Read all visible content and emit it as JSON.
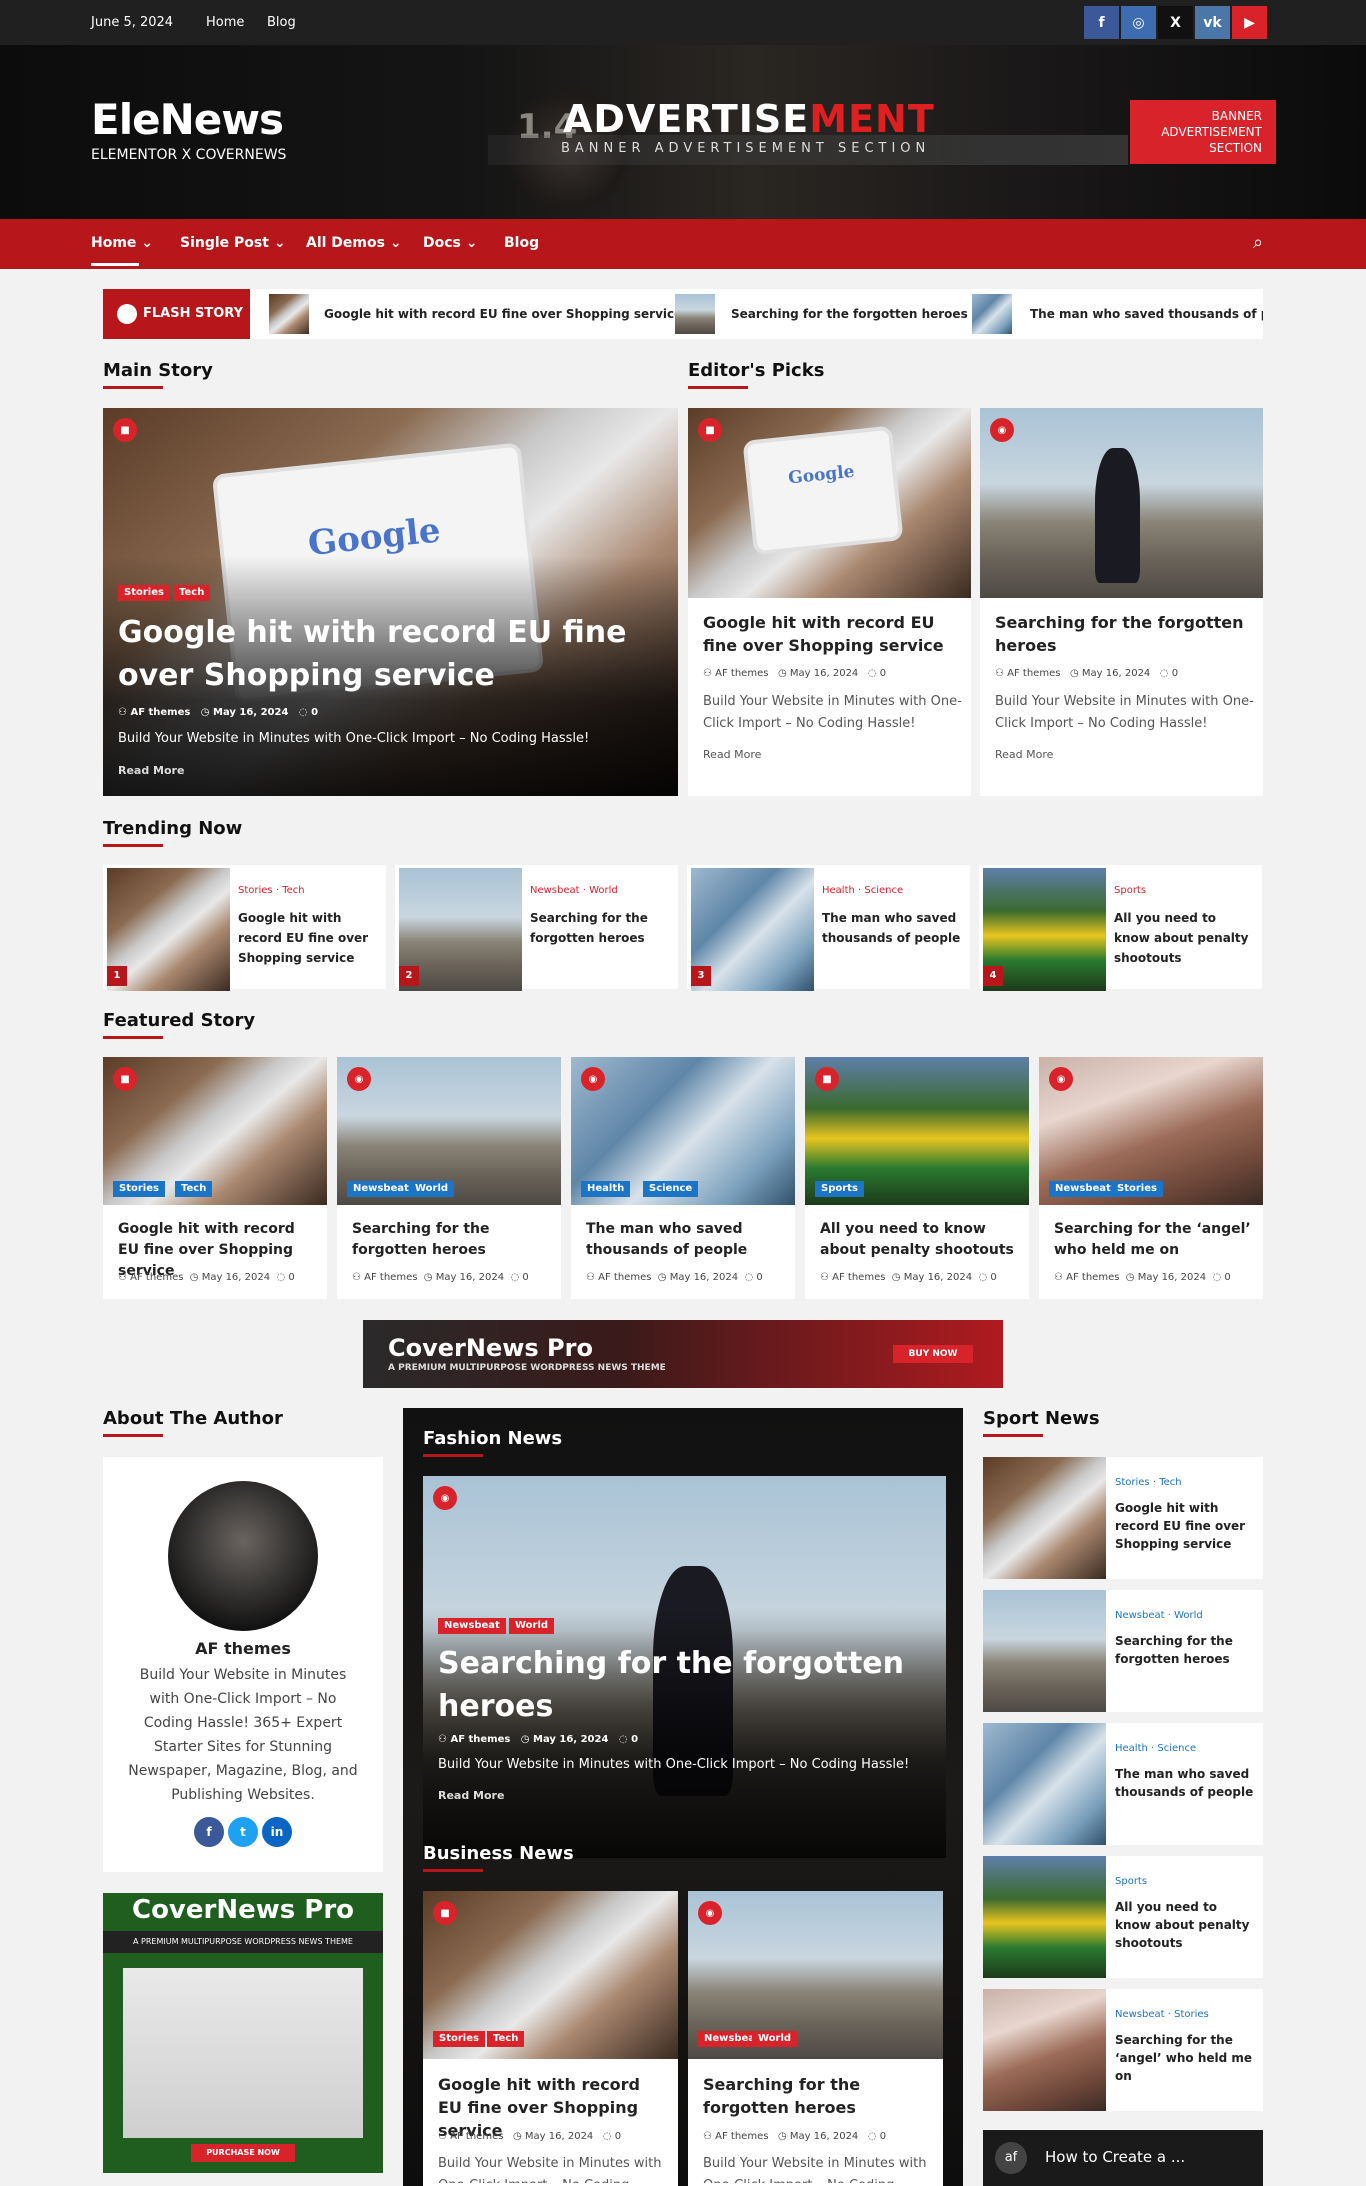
{
  "topbar": {
    "date": "June 5, 2024",
    "links": [
      "Home",
      "Blog"
    ],
    "social": [
      {
        "name": "facebook-icon",
        "glyph": "f",
        "color": "#3b5998"
      },
      {
        "name": "instagram-icon",
        "glyph": "◎",
        "color": "#3e6cb0"
      },
      {
        "name": "x-icon",
        "glyph": "X",
        "color": "#111111"
      },
      {
        "name": "vk-icon",
        "glyph": "vk",
        "color": "#4a76a8"
      },
      {
        "name": "youtube-icon",
        "glyph": "▶",
        "color": "#d9232a"
      }
    ]
  },
  "header": {
    "logo": "EleNews",
    "tagline": "ELEMENTOR X COVERNEWS",
    "ad_title_a": "ADVERTISE",
    "ad_title_b": "MENT",
    "ad_sub": "BANNER ADVERTISEMENT SECTION",
    "ad_badge": [
      "BANNER",
      "ADVERTISEMENT",
      "SECTION"
    ],
    "ad_lens_text": "1.4"
  },
  "nav": {
    "items": [
      "Home",
      "Single Post",
      "All Demos",
      "Docs",
      "Blog"
    ]
  },
  "flash": {
    "label": "FLASH STORY",
    "items": [
      "Google hit with record EU fine over Shopping service",
      "Searching for the forgotten heroes",
      "The man who saved thousands of peop"
    ]
  },
  "sections": {
    "main": "Main Story",
    "editors": "Editor's Picks",
    "trending": "Trending Now",
    "featured": "Featured Story",
    "about": "About The Author",
    "fashion": "Fashion News",
    "business": "Business News",
    "sport": "Sport News"
  },
  "common": {
    "author": "AF themes",
    "date": "May 16, 2024",
    "comments": "0",
    "excerpt": "Build Your Website in Minutes with One-Click Import – No Coding Hassle!",
    "read_more": "Read More"
  },
  "main_story": {
    "tags": [
      "Stories",
      "Tech"
    ],
    "title": "Google hit with record EU fine over Shopping service",
    "excerpt": "Build Your Website in Minutes with One-Click Import – No Coding Hassle!"
  },
  "editors": [
    {
      "title": "Google hit with record EU fine over Shopping service"
    },
    {
      "title": "Searching for the forgotten heroes"
    }
  ],
  "trending": [
    {
      "cats": [
        "Stories",
        "Tech"
      ],
      "title": "Google hit with record EU fine over Shopping service",
      "num": "1"
    },
    {
      "cats": [
        "Newsbeat",
        "World"
      ],
      "title": "Searching for the forgotten heroes",
      "num": "2"
    },
    {
      "cats": [
        "Health",
        "Science"
      ],
      "title": "The man who saved thousands of people",
      "num": "3"
    },
    {
      "cats": [
        "Sports"
      ],
      "title": "All you need to know about penalty shootouts",
      "num": "4"
    }
  ],
  "featured": [
    {
      "tags": [
        "Stories",
        "Tech"
      ],
      "title": "Google hit with record EU fine over Shopping service"
    },
    {
      "tags": [
        "Newsbeat",
        "World"
      ],
      "title": "Searching for the forgotten heroes"
    },
    {
      "tags": [
        "Health",
        "Science"
      ],
      "title": "The man who saved thousands of people"
    },
    {
      "tags": [
        "Sports"
      ],
      "title": "All you need to know about penalty shootouts"
    },
    {
      "tags": [
        "Newsbeat",
        "Stories"
      ],
      "title": "Searching for the ‘angel’ who held me on"
    }
  ],
  "promo": {
    "title": "CoverNews Pro",
    "sub": "A PREMIUM MULTIPURPOSE WORDPRESS NEWS THEME",
    "button": "BUY NOW"
  },
  "author": {
    "name": "AF themes",
    "bio": "Build Your Website in Minutes with One-Click Import – No Coding Hassle! 365+ Expert Starter Sites for Stunning Newspaper, Magazine, Blog, and Publishing Websites."
  },
  "author_promo": {
    "title": "CoverNews Pro",
    "sub": "A PREMIUM MULTIPURPOSE WORDPRESS NEWS THEME",
    "button": "PURCHASE NOW"
  },
  "fashion": {
    "tags": [
      "Newsbeat",
      "World"
    ],
    "title": "Searching for the forgotten heroes",
    "excerpt": "Build Your Website in Minutes with One-Click Import – No Coding Hassle!"
  },
  "business": [
    {
      "tags": [
        "Stories",
        "Tech"
      ],
      "title": "Google hit with record EU fine over Shopping service"
    },
    {
      "tags": [
        "Newsbeat",
        "World"
      ],
      "title": "Searching for the forgotten heroes"
    }
  ],
  "sport": [
    {
      "cats": [
        "Stories",
        "Tech"
      ],
      "title": "Google hit with record EU fine over Shopping service"
    },
    {
      "cats": [
        "Newsbeat",
        "World"
      ],
      "title": "Searching for the forgotten heroes"
    },
    {
      "cats": [
        "Health",
        "Science"
      ],
      "title": "The man who saved thousands of people"
    },
    {
      "cats": [
        "Sports"
      ],
      "title": "All you need to know about penalty shootouts"
    },
    {
      "cats": [
        "Newsbeat",
        "Stories"
      ],
      "title": "Searching for the ‘angel’ who held me on"
    }
  ],
  "video": {
    "title": "How to Create a ..."
  }
}
